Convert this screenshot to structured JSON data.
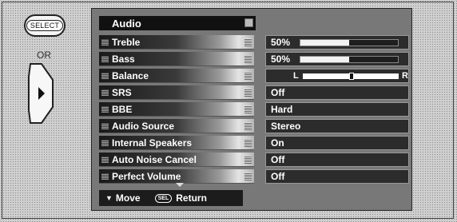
{
  "remote": {
    "select_label": "SELECT",
    "or_label": "OR",
    "pad_icon": "play-right-icon"
  },
  "menu": {
    "title": "Audio",
    "rows": [
      {
        "label": "Treble",
        "value": "50%",
        "level": 0.5,
        "kind": "bar"
      },
      {
        "label": "Bass",
        "value": "50%",
        "level": 0.5,
        "kind": "bar"
      },
      {
        "label": "Balance",
        "value": "",
        "kind": "balance",
        "left": "L",
        "right": "R",
        "position": 0.5
      },
      {
        "label": "SRS",
        "value": "Off",
        "kind": "text"
      },
      {
        "label": "BBE",
        "value": "Hard",
        "kind": "text"
      },
      {
        "label": "Audio Source",
        "value": "Stereo",
        "kind": "text"
      },
      {
        "label": "Internal Speakers",
        "value": "On",
        "kind": "text"
      },
      {
        "label": "Auto Noise Cancel",
        "value": "Off",
        "kind": "text"
      },
      {
        "label": "Perfect Volume",
        "value": "Off",
        "kind": "text"
      }
    ]
  },
  "footer": {
    "move_label": "Move",
    "sel_icon_text": "SEL",
    "return_label": "Return"
  }
}
